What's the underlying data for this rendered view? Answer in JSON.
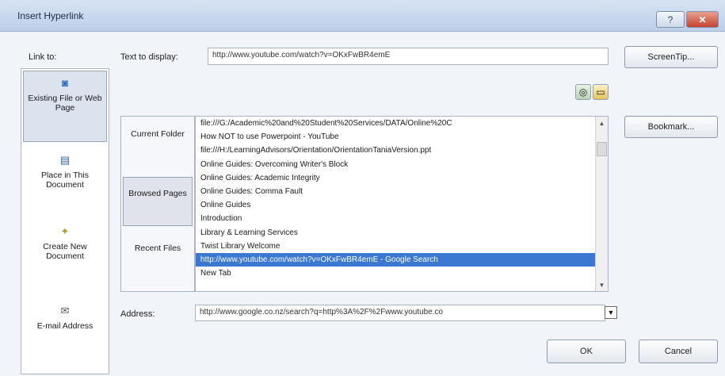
{
  "window": {
    "title": "Insert Hyperlink",
    "help_label": "?",
    "close_label": "✕"
  },
  "link_to": {
    "label": "Link to:",
    "items": [
      {
        "label": "Existing File or Web Page",
        "icon": "globe-file-icon",
        "selected": true
      },
      {
        "label": "Place in This Document",
        "icon": "document-place-icon",
        "selected": false
      },
      {
        "label": "Create New Document",
        "icon": "new-document-icon",
        "selected": false
      },
      {
        "label": "E-mail Address",
        "icon": "email-icon",
        "selected": false
      }
    ]
  },
  "text_to_display": {
    "label": "Text to display:",
    "value": "http://www.youtube.com/watch?v=OKxFwBR4emE"
  },
  "buttons": {
    "screentip": "ScreenTip...",
    "bookmark": "Bookmark...",
    "ok": "OK",
    "cancel": "Cancel"
  },
  "look_in": {
    "items": [
      {
        "label": "Current Folder",
        "selected": false
      },
      {
        "label": "Browsed Pages",
        "selected": true
      },
      {
        "label": "Recent Files",
        "selected": false
      }
    ]
  },
  "toolbar_icons": [
    "browse-web-icon",
    "browse-file-icon"
  ],
  "file_list": [
    {
      "text": "file:///G:/Academic%20and%20Student%20Services/DATA/Online%20C",
      "selected": false
    },
    {
      "text": "How NOT to use Powerpoint - YouTube",
      "selected": false
    },
    {
      "text": "file:///H:/LearningAdvisors/Orientation/OrientationTaniaVersion.ppt",
      "selected": false
    },
    {
      "text": "Online Guides: Overcoming Writer's Block",
      "selected": false
    },
    {
      "text": "Online Guides: Academic Integrity",
      "selected": false
    },
    {
      "text": "Online Guides: Comma Fault",
      "selected": false
    },
    {
      "text": "Online Guides",
      "selected": false
    },
    {
      "text": "Introduction",
      "selected": false
    },
    {
      "text": "Library & Learning Services",
      "selected": false
    },
    {
      "text": "Twist Library Welcome",
      "selected": false
    },
    {
      "text": "http://www.youtube.com/watch?v=OKxFwBR4emE - Google Search",
      "selected": true
    },
    {
      "text": "New Tab",
      "selected": false
    }
  ],
  "address": {
    "label": "Address:",
    "value": "http://www.google.co.nz/search?q=http%3A%2F%2Fwww.youtube.co"
  },
  "colors": {
    "selection": "#3a78d1",
    "close": "#c5422f"
  }
}
